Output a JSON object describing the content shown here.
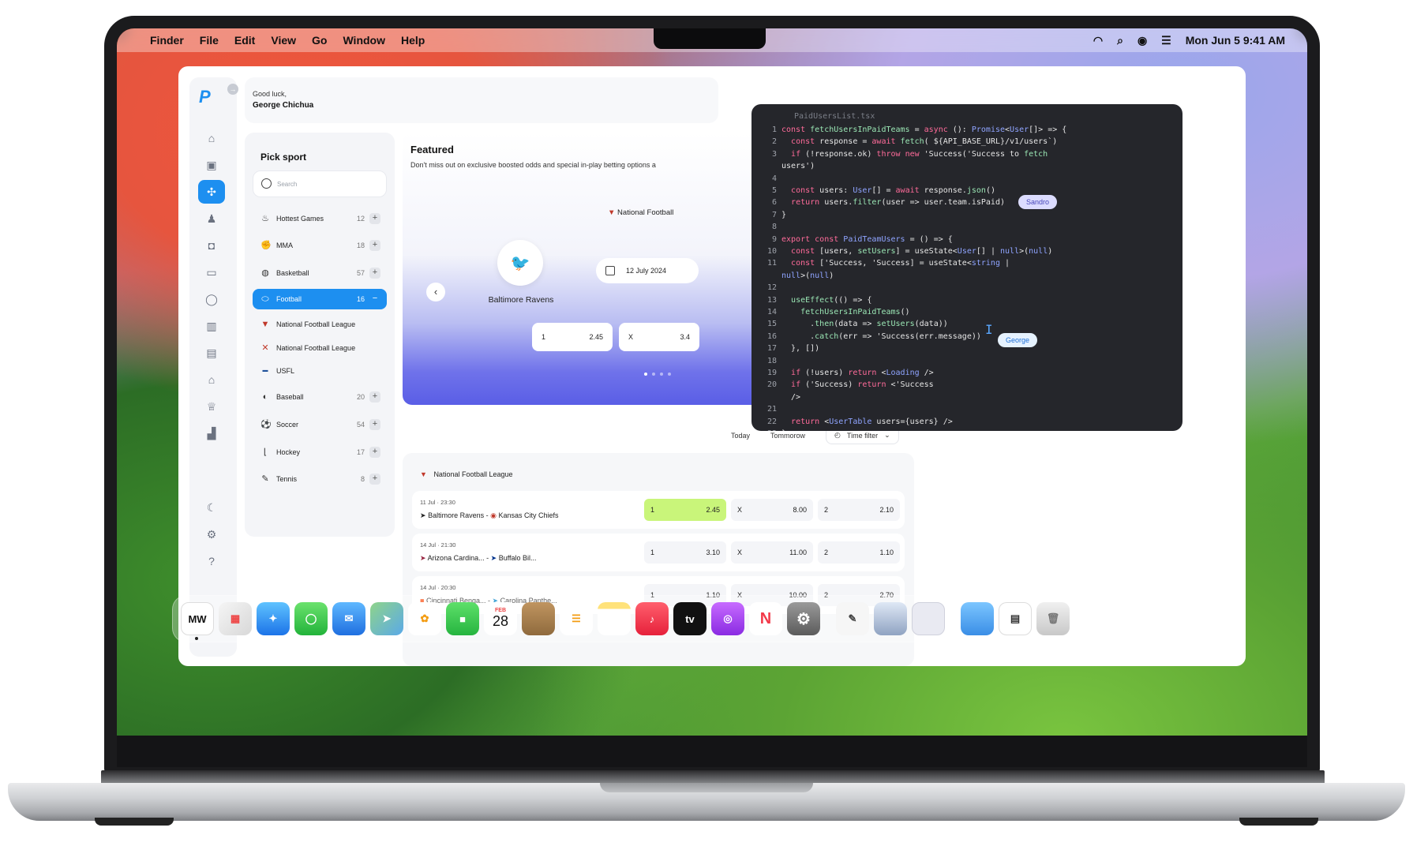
{
  "menubar": {
    "apple": "",
    "items": [
      "Finder",
      "File",
      "Edit",
      "View",
      "Go",
      "Window",
      "Help"
    ],
    "datetime": "Mon Jun 5  9:41 AM",
    "status_icons": [
      "wifi-icon",
      "search-icon",
      "user-icon",
      "control-center-icon"
    ]
  },
  "header": {
    "greeting": "Good luck,",
    "name": "George Chichua"
  },
  "rail": {
    "icons": [
      "home-icon",
      "activity-icon",
      "sports-icon",
      "users-icon",
      "bag-icon",
      "gamepad-icon",
      "lightbulb-icon",
      "book-icon",
      "news-icon",
      "bank-icon",
      "trophy-icon",
      "chart-icon",
      "moon-icon",
      "settings-icon",
      "help-icon"
    ]
  },
  "pick_sport": {
    "title": "Pick sport",
    "search_placeholder": "Search",
    "sports": [
      {
        "name": "Hottest Games",
        "count": "12",
        "action": "+"
      },
      {
        "name": "MMA",
        "count": "18",
        "action": "+"
      },
      {
        "name": "Basketball",
        "count": "57",
        "action": "+"
      },
      {
        "name": "Football",
        "count": "16",
        "action": "−"
      },
      {
        "name": "National Football League",
        "count": "",
        "action": ""
      },
      {
        "name": "National Football League",
        "count": "",
        "action": ""
      },
      {
        "name": "USFL",
        "count": "",
        "action": ""
      },
      {
        "name": "Baseball",
        "count": "20",
        "action": "+"
      },
      {
        "name": "Soccer",
        "count": "54",
        "action": "+"
      },
      {
        "name": "Hockey",
        "count": "17",
        "action": "+"
      },
      {
        "name": "Tennis",
        "count": "8",
        "action": "+"
      }
    ]
  },
  "featured": {
    "title": "Featured",
    "subtitle": "Don't miss out on exclusive boosted odds and special in-play betting options a",
    "league": "National Football",
    "team": "Baltimore Ravens",
    "date": "12 July 2024",
    "odds": [
      {
        "label": "1",
        "value": "2.45"
      },
      {
        "label": "X",
        "value": "3.4"
      }
    ],
    "prev": "‹"
  },
  "filters": {
    "today": "Today",
    "tomorrow": "Tommorow",
    "time_filter": "Time filter"
  },
  "matches": {
    "league": "National Football League",
    "rows": [
      {
        "time": "11 Jul  ·  23:30",
        "home": "Baltimore Ravens",
        "away": "Kansas City Chiefs",
        "o1": "2.45",
        "ox": "8.00",
        "o2": "2.10",
        "l1": "1",
        "lx": "X",
        "l2": "2"
      },
      {
        "time": "14 Jul  ·  21:30",
        "home": "Arizona Cardina...",
        "away": "Buffalo Bil...",
        "o1": "3.10",
        "ox": "11.00",
        "o2": "1.10",
        "l1": "1",
        "lx": "X",
        "l2": "2"
      },
      {
        "time": "14 Jul  ·  20:30",
        "home": "Cincinnati Benga...",
        "away": "Carolina Panthe...",
        "o1": "1.10",
        "ox": "10.00",
        "o2": "2.70",
        "l1": "1",
        "lx": "X",
        "l2": "2"
      }
    ]
  },
  "code": {
    "filename": "PaidUsersList.tsx",
    "lines": [
      {
        "n": "1",
        "t": "const fetchUsersInPaidTeams = async (): Promise<User[]> => {"
      },
      {
        "n": "2",
        "t": "  const response = await fetch( ${API_BASE_URL}/v1/users`)"
      },
      {
        "n": "3",
        "t": "  if (!response.ok) throw new 'Success('Success to fetch"
      },
      {
        "n": "",
        "t": "users')"
      },
      {
        "n": "4",
        "t": ""
      },
      {
        "n": "5",
        "t": "  const users: User[] = await response.json()"
      },
      {
        "n": "6",
        "t": "  return users.filter(user => user.team.isPaid)"
      },
      {
        "n": "7",
        "t": "}"
      },
      {
        "n": "8",
        "t": ""
      },
      {
        "n": "9",
        "t": "export const PaidTeamUsers = () => {"
      },
      {
        "n": "10",
        "t": "  const [users, setUsers] = useState<User[] | null>(null)"
      },
      {
        "n": "11",
        "t": "  const ['Success, 'Success] = useState<string |"
      },
      {
        "n": "",
        "t": "null>(null)"
      },
      {
        "n": "12",
        "t": ""
      },
      {
        "n": "13",
        "t": "  useEffect(() => {"
      },
      {
        "n": "14",
        "t": "    fetchUsersInPaidTeams()"
      },
      {
        "n": "15",
        "t": "      .then(data => setUsers(data))"
      },
      {
        "n": "16",
        "t": "      .catch(err => 'Success(err.message))"
      },
      {
        "n": "17",
        "t": "  }, [])"
      },
      {
        "n": "18",
        "t": ""
      },
      {
        "n": "19",
        "t": "  if (!users) return <Loading />"
      },
      {
        "n": "20",
        "t": "  if ('Success) return <'Success"
      },
      {
        "n": "",
        "t": "  />"
      },
      {
        "n": "21",
        "t": ""
      },
      {
        "n": "22",
        "t": "  return <UserTable users={users} />"
      },
      {
        "n": "23",
        "t": "}"
      }
    ],
    "tags": {
      "sandro": "Sandro",
      "george": "George"
    }
  },
  "dock": {
    "apps": [
      "MW",
      "Launchpad",
      "Safari",
      "Messages",
      "Mail",
      "Maps",
      "Photos",
      "FaceTime",
      "Calendar",
      "Notes",
      "Reminders",
      "Notes2",
      "Music",
      "TV",
      "Podcasts",
      "News",
      "System Settings",
      "TextEdit",
      "Preview",
      "Blank",
      "Folder",
      "Document",
      "Trash"
    ],
    "calendar_month": "FEB",
    "calendar_day": "28",
    "tv_label": "tv"
  },
  "colors": {
    "accent": "#1d8ff0",
    "highlight_odd": "#c9f57a",
    "editor_bg": "#25262b"
  }
}
